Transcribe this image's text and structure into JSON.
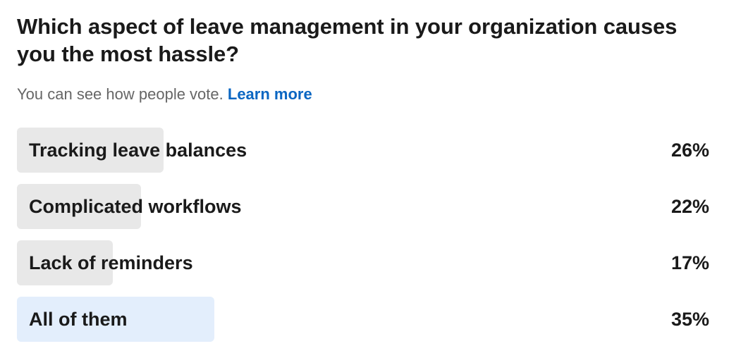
{
  "poll": {
    "question": "Which aspect of leave management in your organization causes you the most hassle?",
    "subtitle_text": "You can see how people vote.",
    "learn_more_label": "Learn more",
    "options": [
      {
        "label": "Tracking leave balances",
        "percent_label": "26%",
        "percent": 26,
        "selected": false
      },
      {
        "label": "Complicated workflows",
        "percent_label": "22%",
        "percent": 22,
        "selected": false
      },
      {
        "label": "Lack of reminders",
        "percent_label": "17%",
        "percent": 17,
        "selected": false
      },
      {
        "label": "All of them",
        "percent_label": "35%",
        "percent": 35,
        "selected": true
      }
    ]
  },
  "colors": {
    "bar_default": "#e8e8e8",
    "bar_selected": "#e3eefc",
    "link": "#0a66c2",
    "subtitle": "#666666",
    "text": "#1a1a1a"
  }
}
